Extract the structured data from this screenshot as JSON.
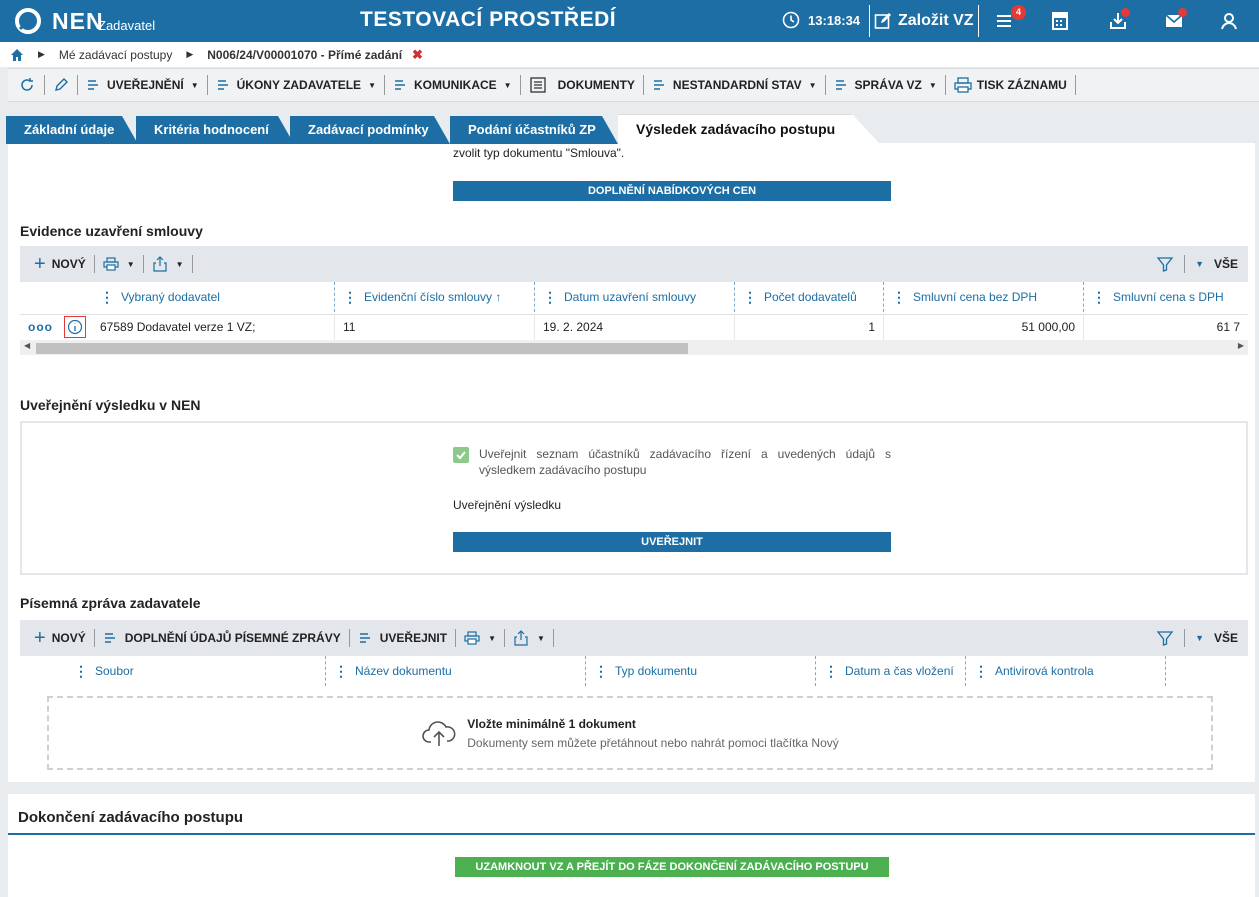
{
  "header": {
    "brand": "NEN",
    "subtitle": "Zadavatel",
    "env_title": "TESTOVACÍ PROSTŘEDÍ",
    "time": "13:18:34",
    "create_label": "Založit VZ",
    "notif_count": "4"
  },
  "breadcrumb": {
    "item1": "Mé zadávací postupy",
    "item2": "N006/24/V00001070 - Přímé zadání",
    "close": "✖"
  },
  "toolbar": {
    "uverejneni": "UVEŘEJNĚNÍ",
    "ukony": "ÚKONY ZADAVATELE",
    "komunikace": "KOMUNIKACE",
    "dokumenty": "DOKUMENTY",
    "nestandardni": "NESTANDARDNÍ STAV",
    "sprava": "SPRÁVA VZ",
    "tisk": "TISK ZÁZNAMU"
  },
  "tabs": {
    "t1": "Základní údaje",
    "t2": "Kritéria hodnocení",
    "t3": "Zadávací podmínky",
    "t4": "Podání účastníků ZP",
    "t5": "Výsledek zadávacího postupu"
  },
  "top_note": "zvolit typ dokumentu \"Smlouva\".",
  "doplneni_button": "DOPLNĚNÍ NABÍDKOVÝCH CEN",
  "evidence": {
    "title": "Evidence uzavření smlouvy",
    "new_label": "NOVÝ",
    "all_label": "VŠE",
    "columns": [
      "Vybraný dodavatel",
      "Evidenční číslo smlouvy ↑",
      "Datum uzavření smlouvy",
      "Počet dodavatelů",
      "Smluvní cena bez DPH",
      "Smluvní cena s DPH"
    ],
    "row": {
      "dodavatel": "67589 Dodavatel verze 1 VZ;",
      "cislo": "11",
      "datum": "19. 2. 2024",
      "pocet": "1",
      "bez_dph": "51 000,00",
      "s_dph": "61 7"
    }
  },
  "publication": {
    "title": "Uveřejnění výsledku v NEN",
    "checkbox_label": "Uveřejnit seznam účastníků zadávacího řízení a uvedených údajů s výsledkem zadávacího postupu",
    "checked": true,
    "subheading": "Uveřejnění výsledku",
    "button": "UVEŘEJNIT"
  },
  "report": {
    "title": "Písemná zpráva zadavatele",
    "new_label": "NOVÝ",
    "doplneni_label": "DOPLNĚNÍ ÚDAJŮ PÍSEMNÉ ZPRÁVY",
    "publish_label": "UVEŘEJNIT",
    "all_label": "VŠE",
    "columns": [
      "Soubor",
      "Název dokumentu",
      "Typ dokumentu",
      "Datum a čas vložení",
      "Antivirová kontrola"
    ],
    "drop_title": "Vložte minimálně 1 dokument",
    "drop_hint": "Dokumenty sem můžete přetáhnout nebo nahrát pomoci tlačítka Nový"
  },
  "completion": {
    "title": "Dokončení zadávacího postupu",
    "button": "UZAMKNOUT VZ A PŘEJÍT DO FÁZE DOKONČENÍ ZADÁVACÍHO POSTUPU"
  },
  "colors": {
    "primary": "#1c6ea4",
    "success": "#4caf50",
    "danger": "#e53935"
  }
}
